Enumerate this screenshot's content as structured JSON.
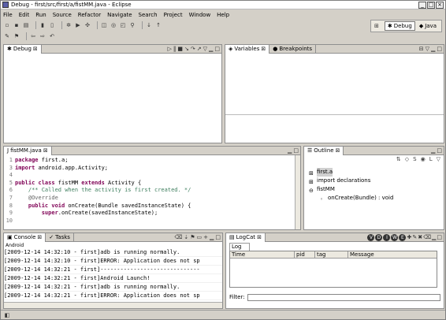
{
  "window": {
    "title": "Debug - first/src/first/a/fistMM.java - Eclipse",
    "min": "_",
    "max": "□",
    "close": "×"
  },
  "menu": [
    "File",
    "Edit",
    "Run",
    "Source",
    "Refactor",
    "Navigate",
    "Search",
    "Project",
    "Window",
    "Help"
  ],
  "perspectives": {
    "debug": "Debug",
    "java": "Java"
  },
  "debug_view": {
    "tab": "Debug"
  },
  "variables_view": {
    "tab_variables": "Variables",
    "tab_breakpoints": "Breakpoints"
  },
  "editor": {
    "tab": "fistMM.java",
    "lines": [
      {
        "num": "1",
        "parts": [
          {
            "t": "package",
            "c": "kw"
          },
          {
            "t": " first.a;",
            "c": ""
          }
        ]
      },
      {
        "num": "3",
        "parts": [
          {
            "t": "import",
            "c": "kw"
          },
          {
            "t": " android.app.Activity;",
            "c": ""
          }
        ]
      },
      {
        "num": "4",
        "parts": [
          {
            "t": "",
            "c": ""
          }
        ]
      },
      {
        "num": "5",
        "parts": [
          {
            "t": "public class",
            "c": "kw"
          },
          {
            "t": " fistMM ",
            "c": ""
          },
          {
            "t": "extends",
            "c": "kw"
          },
          {
            "t": " Activity {",
            "c": ""
          }
        ]
      },
      {
        "num": "6",
        "parts": [
          {
            "t": "    /** Called when the activity is first created. */",
            "c": "cm"
          }
        ]
      },
      {
        "num": "7",
        "parts": [
          {
            "t": "    @Override",
            "c": "an"
          }
        ]
      },
      {
        "num": "8",
        "parts": [
          {
            "t": "    public void",
            "c": "kw"
          },
          {
            "t": " onCreate(Bundle savedInstanceState) {",
            "c": ""
          }
        ]
      },
      {
        "num": "9",
        "parts": [
          {
            "t": "        super",
            "c": "kw"
          },
          {
            "t": ".onCreate(savedInstanceState);",
            "c": ""
          }
        ]
      },
      {
        "num": "10",
        "parts": [
          {
            "t": "",
            "c": ""
          }
        ]
      }
    ]
  },
  "outline": {
    "tab": "Outline",
    "items": [
      {
        "label": "first.a",
        "indent": 0,
        "sel": true
      },
      {
        "label": "import declarations",
        "indent": 0,
        "sel": false
      },
      {
        "label": "fistMM",
        "indent": 0,
        "sel": false
      },
      {
        "label": "onCreate(Bundle) : void",
        "indent": 1,
        "sel": false
      }
    ]
  },
  "console": {
    "tab_console": "Console",
    "tab_tasks": "Tasks",
    "label": "Android",
    "lines": [
      "[2009-12-14 14:32:10 - first]adb is running normally.",
      "[2009-12-14 14:32:10 - first]ERROR: Application does not sp",
      "[2009-12-14 14:32:21 - first]------------------------------",
      "[2009-12-14 14:32:21 - first]Android Launch!",
      "[2009-12-14 14:32:21 - first]adb is running normally.",
      "[2009-12-14 14:32:21 - first]ERROR: Application does not sp"
    ]
  },
  "logcat": {
    "tab": "LogCat",
    "subtab": "Log",
    "levels": [
      "V",
      "D",
      "I",
      "W",
      "E"
    ],
    "columns": [
      "Time",
      "pid",
      "tag",
      "Message"
    ],
    "filter_label": "Filter:",
    "filter_value": ""
  }
}
